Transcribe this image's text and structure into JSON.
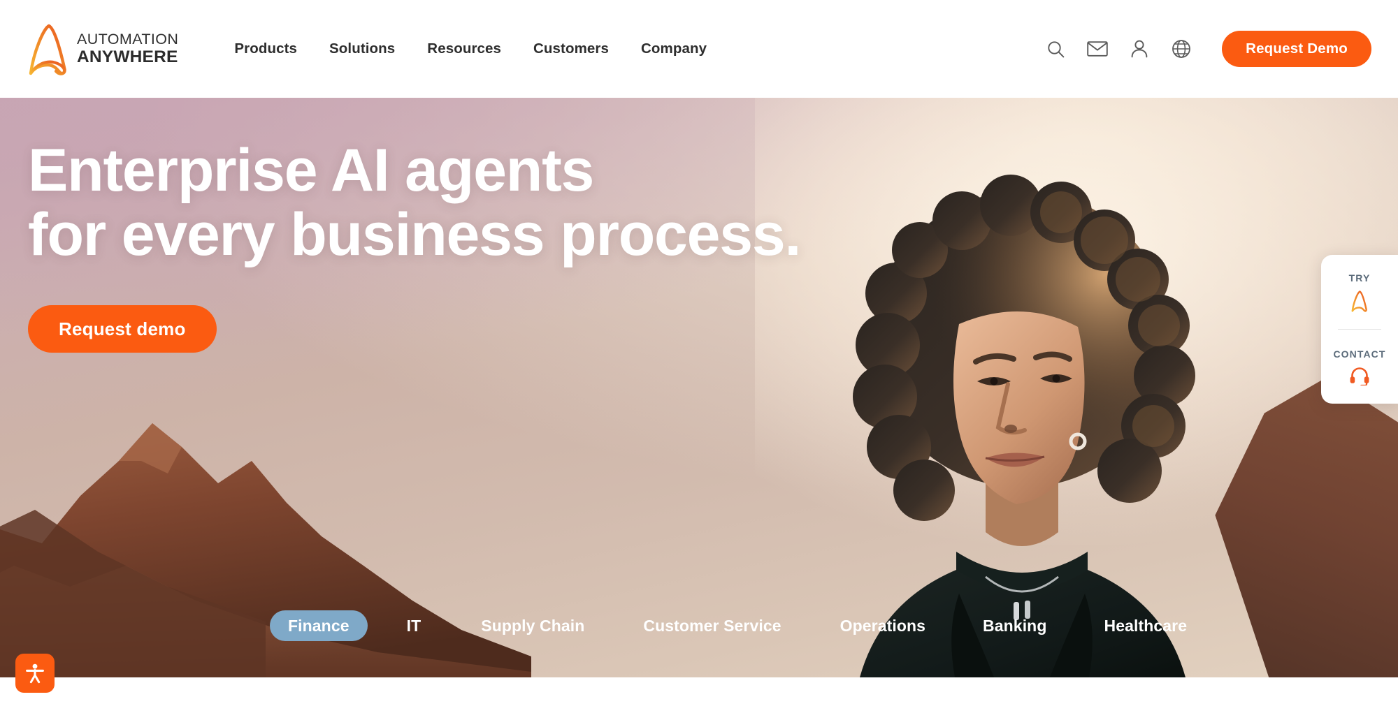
{
  "header": {
    "logo": {
      "line1": "AUTOMATION",
      "line2": "ANYWHERE",
      "icon": "automation-anywhere-a-logo"
    },
    "nav": [
      {
        "label": "Products"
      },
      {
        "label": "Solutions"
      },
      {
        "label": "Resources"
      },
      {
        "label": "Customers"
      },
      {
        "label": "Company"
      }
    ],
    "icons": [
      {
        "name": "search-icon"
      },
      {
        "name": "mail-icon"
      },
      {
        "name": "user-icon"
      },
      {
        "name": "globe-icon"
      }
    ],
    "cta_label": "Request Demo"
  },
  "hero": {
    "headline_line1": "Enterprise AI agents",
    "headline_line2": "for every business process.",
    "cta_label": "Request demo",
    "tabs": [
      {
        "label": "Finance",
        "active": true
      },
      {
        "label": "IT",
        "active": false
      },
      {
        "label": "Supply Chain",
        "active": false
      },
      {
        "label": "Customer Service",
        "active": false
      },
      {
        "label": "Operations",
        "active": false
      },
      {
        "label": "Banking",
        "active": false
      },
      {
        "label": "Healthcare",
        "active": false
      }
    ]
  },
  "side_widget": {
    "try_label": "TRY",
    "try_icon": "automation-anywhere-a-logo-small",
    "contact_label": "CONTACT",
    "contact_icon": "headset-icon"
  },
  "accessibility": {
    "icon": "accessibility-person-icon"
  },
  "colors": {
    "brand_orange": "#fb5b11",
    "active_tab_blue": "#7fa9c8",
    "nav_text": "#2e2e2e",
    "widget_label": "#5b6b7a"
  }
}
